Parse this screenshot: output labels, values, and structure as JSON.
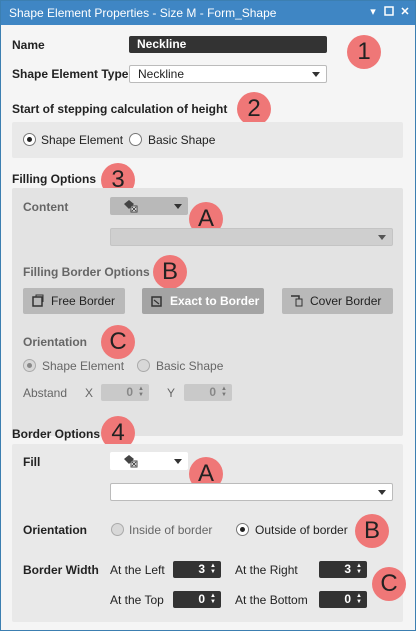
{
  "window": {
    "title": "Shape Element Properties - Size M - Form_Shape",
    "icons": [
      "pin-icon",
      "maximize-icon",
      "close-icon"
    ]
  },
  "name": {
    "label": "Name",
    "value": "Neckline"
  },
  "shape_type": {
    "label": "Shape Element Type",
    "value": "Neckline"
  },
  "stepping": {
    "title": "Start of stepping calculation of height",
    "options": [
      "Shape Element",
      "Basic Shape"
    ],
    "selected": "Shape Element"
  },
  "filling": {
    "title": "Filling Options",
    "content_label": "Content",
    "border_options_title": "Filling Border Options",
    "buttons": {
      "free": "Free Border",
      "exact": "Exact to Border",
      "cover": "Cover Border"
    },
    "orientation_label": "Orientation",
    "orientation_options": [
      "Shape Element",
      "Basic Shape"
    ],
    "abstand_label": "Abstand",
    "x_label": "X",
    "y_label": "Y",
    "x_value": "0",
    "y_value": "0"
  },
  "border": {
    "title": "Border Options",
    "fill_label": "Fill",
    "orientation_label": "Orientation",
    "orientation_options": [
      "Inside of border",
      "Outside of border"
    ],
    "selected_orientation": "Outside of border",
    "width_label": "Border Width",
    "left_label": "At the Left",
    "left_value": "3",
    "right_label": "At the Right",
    "right_value": "3",
    "top_label": "At the Top",
    "top_value": "0",
    "bottom_label": "At the Bottom",
    "bottom_value": "0"
  },
  "badges": {
    "b1": "1",
    "b2": "2",
    "b3": "3",
    "b4": "4",
    "a1": "A",
    "b_fill": "B",
    "c_fill": "C",
    "a2": "A",
    "b_border": "B",
    "c_border": "C"
  }
}
